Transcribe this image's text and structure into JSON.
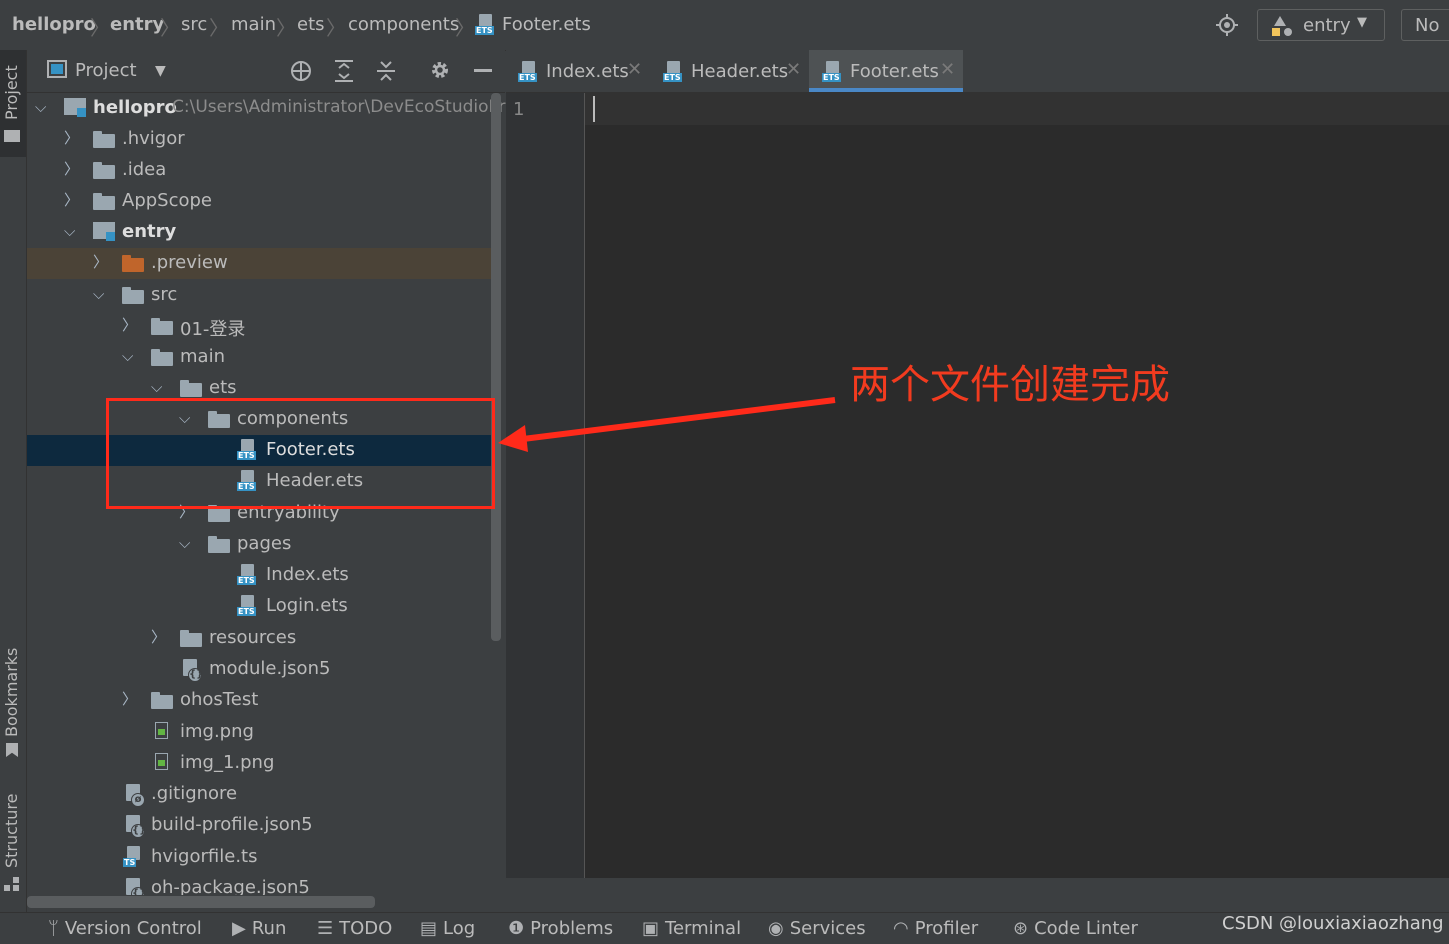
{
  "breadcrumb": [
    {
      "label": "hellopro",
      "bold": true
    },
    {
      "label": "entry",
      "bold": true
    },
    {
      "label": "src"
    },
    {
      "label": "main"
    },
    {
      "label": "ets"
    },
    {
      "label": "components"
    },
    {
      "label": "Footer.ets"
    }
  ],
  "toolbar": {
    "run_config": "entry",
    "device": "No"
  },
  "left_strip": {
    "project": "Project",
    "bookmarks": "Bookmarks",
    "structure": "Structure"
  },
  "panel": {
    "title": "Project"
  },
  "tree": [
    {
      "label": "hellopro",
      "path": "C:\\Users\\Administrator\\DevEcoStudioPro",
      "type": "module",
      "open": true
    },
    {
      "label": ".hvigor",
      "type": "folder"
    },
    {
      "label": ".idea",
      "type": "folder"
    },
    {
      "label": "AppScope",
      "type": "folder"
    },
    {
      "label": "entry",
      "type": "module",
      "open": true
    },
    {
      "label": ".preview",
      "type": "folder-orange"
    },
    {
      "label": "src",
      "type": "folder",
      "open": true
    },
    {
      "label": "01-登录",
      "type": "folder"
    },
    {
      "label": "main",
      "type": "folder",
      "open": true
    },
    {
      "label": "ets",
      "type": "folder",
      "open": true
    },
    {
      "label": "components",
      "type": "folder",
      "open": true
    },
    {
      "label": "Footer.ets",
      "type": "ets",
      "selected": true
    },
    {
      "label": "Header.ets",
      "type": "ets"
    },
    {
      "label": "entryability",
      "type": "folder"
    },
    {
      "label": "pages",
      "type": "folder",
      "open": true
    },
    {
      "label": "Index.ets",
      "type": "ets"
    },
    {
      "label": "Login.ets",
      "type": "ets"
    },
    {
      "label": "resources",
      "type": "folder"
    },
    {
      "label": "module.json5",
      "type": "json"
    },
    {
      "label": "ohosTest",
      "type": "folder"
    },
    {
      "label": "img.png",
      "type": "image"
    },
    {
      "label": "img_1.png",
      "type": "image"
    },
    {
      "label": ".gitignore",
      "type": "ignore"
    },
    {
      "label": "build-profile.json5",
      "type": "json"
    },
    {
      "label": "hvigorfile.ts",
      "type": "ts"
    },
    {
      "label": "oh-package.json5",
      "type": "json"
    }
  ],
  "editor_tabs": [
    {
      "label": "Index.ets",
      "active": false
    },
    {
      "label": "Header.ets",
      "active": false
    },
    {
      "label": "Footer.ets",
      "active": true
    }
  ],
  "editor": {
    "line_number": "1"
  },
  "bottom_tools": [
    "Version Control",
    "Run",
    "TODO",
    "Log",
    "Problems",
    "Terminal",
    "Services",
    "Profiler",
    "Code Linter"
  ],
  "watermark": "CSDN @louxiaxiaozhang",
  "annotation": "两个文件创建完成",
  "colors": {
    "annotation": "#ff2a1a",
    "selection": "#0d293e",
    "preview_row": "#4b4337",
    "accent": "#4a88c7"
  }
}
